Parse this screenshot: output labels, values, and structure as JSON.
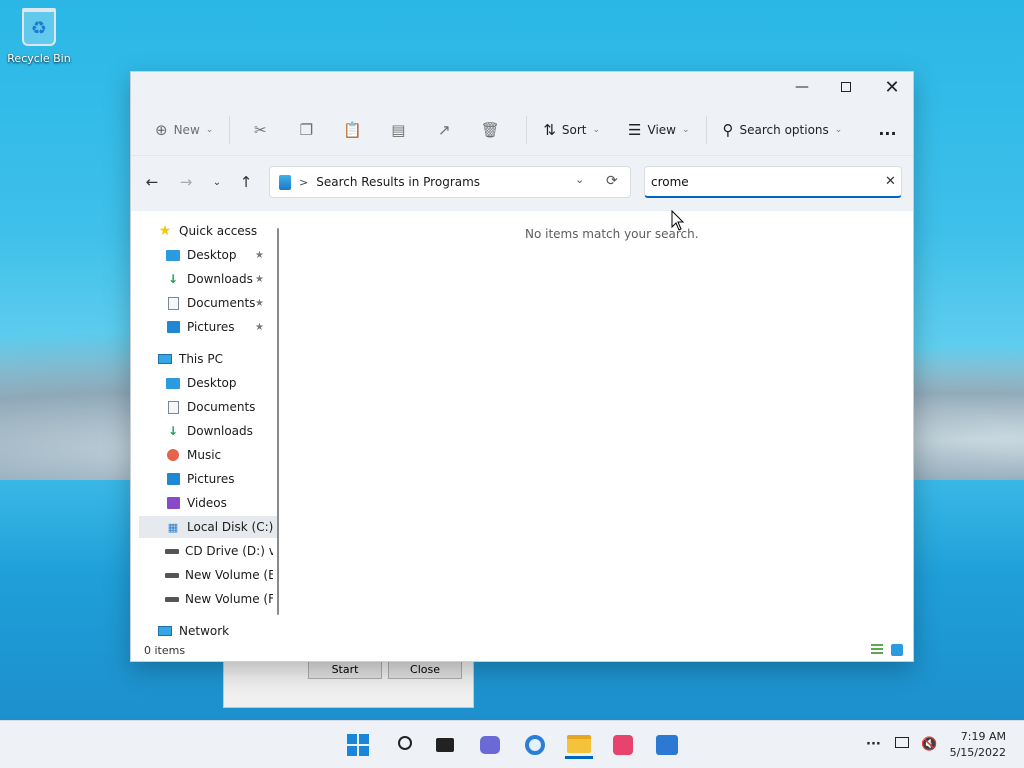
{
  "desktop": {
    "recycle_bin_label": "Recycle Bin"
  },
  "background_dialog": {
    "start_label": "Start",
    "close_label": "Close"
  },
  "toolbar": {
    "new_label": "New",
    "sort_label": "Sort",
    "view_label": "View",
    "search_options_label": "Search options",
    "more_label": "..."
  },
  "address_bar": {
    "path_separator": ">",
    "location": "Search Results in Programs"
  },
  "search": {
    "value": "crome"
  },
  "sidebar": {
    "quick_access": "Quick access",
    "quick_items": [
      "Desktop",
      "Downloads",
      "Documents",
      "Pictures"
    ],
    "this_pc": "This PC",
    "pc_items": [
      "Desktop",
      "Documents",
      "Downloads",
      "Music",
      "Pictures",
      "Videos",
      "Local Disk (C:)",
      "CD Drive (D:) vi",
      "New Volume (E",
      "New Volume (F"
    ],
    "network": "Network"
  },
  "content": {
    "empty_message": "No items match your search."
  },
  "status": {
    "item_count": "0 items"
  },
  "taskbar": {
    "time": "7:19 AM",
    "date": "5/15/2022"
  },
  "colors": {
    "accent": "#0067c0",
    "window_chrome": "#eef1f6",
    "taskbar": "#eef2f7"
  }
}
